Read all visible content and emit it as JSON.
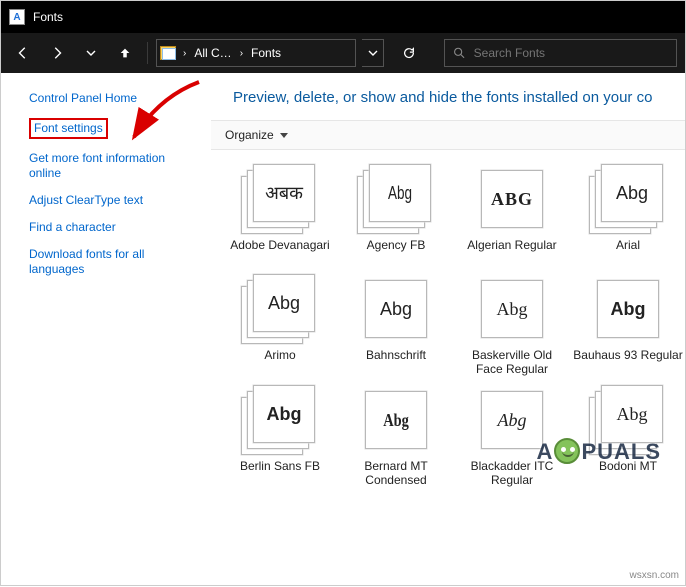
{
  "titlebar": {
    "title": "Fonts"
  },
  "nav": {
    "crumb1": "All C…",
    "crumb2": "Fonts",
    "search_placeholder": "Search Fonts"
  },
  "sidebar": {
    "home": "Control Panel Home",
    "settings": "Font settings",
    "moreinfo": "Get more font information online",
    "cleartype": "Adjust ClearType text",
    "findchar": "Find a character",
    "download": "Download fonts for all languages"
  },
  "main": {
    "title": "Preview, delete, or show and hide the fonts installed on your co",
    "organize": "Organize"
  },
  "fonts": [
    {
      "sample": "अबक",
      "label": "Adobe Devanagari",
      "stack": true,
      "style": "font-family:'Nirmala UI','Segoe UI',serif"
    },
    {
      "sample": "Abg",
      "label": "Agency FB",
      "stack": true,
      "style": "font-family:Arial Narrow,Arial;transform:scaleX(.75)"
    },
    {
      "sample": "ABG",
      "label": "Algerian Regular",
      "stack": false,
      "style": "font-family:serif;font-weight:bold;letter-spacing:1px;font-variant:small-caps"
    },
    {
      "sample": "Abg",
      "label": "Arial",
      "stack": true,
      "style": "font-family:Arial"
    },
    {
      "sample": "Abg",
      "label": "Arimo",
      "stack": true,
      "style": "font-family:Arial"
    },
    {
      "sample": "Abg",
      "label": "Bahnschrift",
      "stack": false,
      "style": "font-family:Bahnschrift,Arial"
    },
    {
      "sample": "Abg",
      "label": "Baskerville Old Face Regular",
      "stack": false,
      "style": "font-family:Baskerville,'Times New Roman',serif"
    },
    {
      "sample": "Abg",
      "label": "Bauhaus 93 Regular",
      "stack": false,
      "style": "font-family:'Arial Black',Arial;font-weight:900"
    },
    {
      "sample": "Abg",
      "label": "Berlin Sans FB",
      "stack": true,
      "style": "font-family:Arial;font-weight:600"
    },
    {
      "sample": "Abg",
      "label": "Bernard MT Condensed",
      "stack": false,
      "style": "font-family:Impact,'Arial Black';font-weight:900;transform:scaleX(.8)"
    },
    {
      "sample": "Abg",
      "label": "Blackadder ITC Regular",
      "stack": false,
      "style": "font-family:'Brush Script MT',cursive;font-style:italic"
    },
    {
      "sample": "Abg",
      "label": "Bodoni MT",
      "stack": true,
      "style": "font-family:'Bodoni MT','Didot',serif"
    }
  ],
  "watermark": {
    "pre": "A",
    "post": "PUALS"
  },
  "sourcemark": "wsxsn.com"
}
